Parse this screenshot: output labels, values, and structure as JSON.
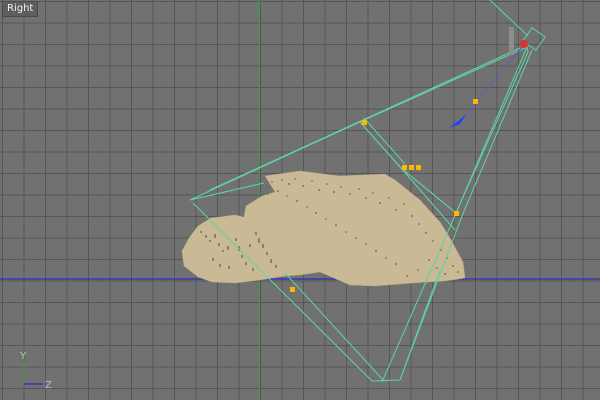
{
  "viewport": {
    "label": "Right",
    "grid_color": "#565656",
    "background_color": "#717171"
  },
  "axis_tripod": {
    "vertical_axis_label": "Y",
    "horizontal_axis_label": "Z"
  },
  "colors": {
    "wireframe": "#5fd3a6",
    "selected_vertex": "#ffb800",
    "rock_fill": "#c9b994",
    "rock_dots": "#6d5f45",
    "world_axis_blue": "#2a2fc4",
    "world_axis_green": "#3d9d3d",
    "camera_body": "#8d8d8d",
    "camera_lens": "#e03030",
    "direction_arrow": "#2040ff"
  }
}
